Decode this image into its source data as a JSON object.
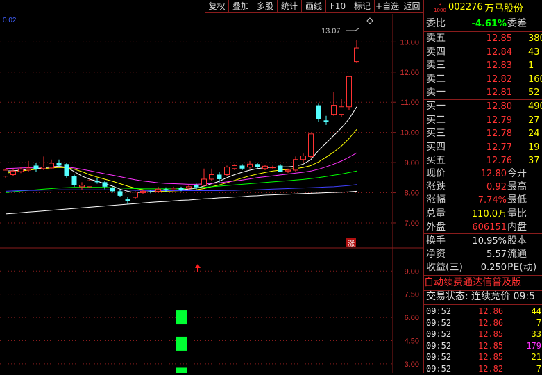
{
  "toolbar": {
    "buttons": [
      "复权",
      "叠加",
      "多股",
      "统计",
      "画线",
      "F10",
      "标记",
      "+自选",
      "返回"
    ]
  },
  "chart_header": {
    "left_value": "0.02",
    "peak_label": "13.07"
  },
  "chart_data": [
    {
      "type": "candlestick",
      "title": "",
      "ylim": [
        6.7,
        13.4
      ],
      "y_ticks": [
        "13.00",
        "12.00",
        "11.00",
        "10.00",
        "9.00",
        "8.00",
        "7.00"
      ],
      "candles": [
        {
          "o": 8.55,
          "c": 8.75,
          "h": 8.8,
          "l": 8.5
        },
        {
          "o": 8.6,
          "c": 8.72,
          "h": 8.78,
          "l": 8.55
        },
        {
          "o": 8.7,
          "c": 8.78,
          "h": 8.85,
          "l": 8.65
        },
        {
          "o": 8.75,
          "c": 8.82,
          "h": 9.05,
          "l": 8.7
        },
        {
          "o": 8.9,
          "c": 8.78,
          "h": 9.0,
          "l": 8.7
        },
        {
          "o": 8.8,
          "c": 8.85,
          "h": 9.2,
          "l": 8.75
        },
        {
          "o": 8.82,
          "c": 8.98,
          "h": 9.1,
          "l": 8.8
        },
        {
          "o": 9.0,
          "c": 8.9,
          "h": 9.1,
          "l": 8.85
        },
        {
          "o": 8.95,
          "c": 8.55,
          "h": 9.0,
          "l": 8.5
        },
        {
          "o": 8.55,
          "c": 8.25,
          "h": 8.6,
          "l": 8.2
        },
        {
          "o": 8.2,
          "c": 8.25,
          "h": 8.35,
          "l": 8.1
        },
        {
          "o": 8.2,
          "c": 8.4,
          "h": 8.45,
          "l": 8.15
        },
        {
          "o": 8.4,
          "c": 8.35,
          "h": 8.48,
          "l": 8.3
        },
        {
          "o": 8.35,
          "c": 8.2,
          "h": 8.4,
          "l": 8.12
        },
        {
          "o": 8.15,
          "c": 8.05,
          "h": 8.2,
          "l": 8.0
        },
        {
          "o": 8.05,
          "c": 7.9,
          "h": 8.1,
          "l": 7.85
        },
        {
          "o": 7.78,
          "c": 7.72,
          "h": 7.85,
          "l": 7.62
        },
        {
          "o": 7.85,
          "c": 8.02,
          "h": 8.05,
          "l": 7.8
        },
        {
          "o": 8.0,
          "c": 8.05,
          "h": 8.1,
          "l": 7.95
        },
        {
          "o": 8.05,
          "c": 8.02,
          "h": 8.1,
          "l": 7.98
        },
        {
          "o": 8.05,
          "c": 8.12,
          "h": 8.2,
          "l": 8.0
        },
        {
          "o": 8.12,
          "c": 8.08,
          "h": 8.18,
          "l": 8.02
        },
        {
          "o": 8.1,
          "c": 8.15,
          "h": 8.2,
          "l": 8.05
        },
        {
          "o": 8.15,
          "c": 8.1,
          "h": 8.2,
          "l": 8.05
        },
        {
          "o": 8.15,
          "c": 8.2,
          "h": 8.25,
          "l": 8.1
        },
        {
          "o": 8.25,
          "c": 8.18,
          "h": 8.3,
          "l": 8.12
        },
        {
          "o": 8.25,
          "c": 8.45,
          "h": 8.8,
          "l": 8.2
        },
        {
          "o": 8.45,
          "c": 8.6,
          "h": 8.8,
          "l": 8.4
        },
        {
          "o": 8.6,
          "c": 8.45,
          "h": 8.7,
          "l": 8.35
        },
        {
          "o": 8.6,
          "c": 8.85,
          "h": 8.9,
          "l": 8.55
        },
        {
          "o": 8.8,
          "c": 8.9,
          "h": 8.95,
          "l": 8.75
        },
        {
          "o": 8.9,
          "c": 8.8,
          "h": 8.95,
          "l": 8.75
        },
        {
          "o": 8.85,
          "c": 8.95,
          "h": 9.05,
          "l": 8.8
        },
        {
          "o": 8.95,
          "c": 8.85,
          "h": 9.0,
          "l": 8.8
        },
        {
          "o": 8.8,
          "c": 8.88,
          "h": 8.92,
          "l": 8.75
        },
        {
          "o": 8.85,
          "c": 8.85,
          "h": 8.9,
          "l": 8.8
        },
        {
          "o": 8.9,
          "c": 8.7,
          "h": 8.95,
          "l": 8.68
        },
        {
          "o": 8.72,
          "c": 8.75,
          "h": 8.8,
          "l": 8.65
        },
        {
          "o": 8.75,
          "c": 9.1,
          "h": 9.2,
          "l": 8.7
        },
        {
          "o": 9.1,
          "c": 9.22,
          "h": 9.3,
          "l": 9.0
        },
        {
          "o": 9.2,
          "c": 9.95,
          "h": 9.95,
          "l": 9.15
        },
        {
          "o": 10.9,
          "c": 10.45,
          "h": 10.95,
          "l": 10.35
        },
        {
          "o": 10.4,
          "c": 10.35,
          "h": 10.55,
          "l": 10.25
        },
        {
          "o": 10.6,
          "c": 10.9,
          "h": 11.35,
          "l": 10.55
        },
        {
          "o": 10.6,
          "c": 10.85,
          "h": 11.1,
          "l": 10.5
        },
        {
          "o": 10.85,
          "c": 11.85,
          "h": 11.85,
          "l": 10.75
        },
        {
          "o": 12.35,
          "c": 12.8,
          "h": 13.07,
          "l": 12.3
        }
      ],
      "series": [
        {
          "color": "#ffffff",
          "values": [
            8.72,
            8.73,
            8.75,
            8.78,
            8.8,
            8.82,
            8.86,
            8.88,
            8.84,
            8.7,
            8.55,
            8.45,
            8.38,
            8.3,
            8.22,
            8.12,
            8.05,
            8.0,
            8.02,
            8.04,
            8.06,
            8.08,
            8.09,
            8.1,
            8.12,
            8.15,
            8.22,
            8.3,
            8.38,
            8.5,
            8.6,
            8.68,
            8.75,
            8.8,
            8.83,
            8.85,
            8.86,
            8.86,
            8.88,
            8.95,
            9.1,
            9.4,
            9.65,
            9.9,
            10.15,
            10.45,
            10.85
          ]
        },
        {
          "color": "#ffff00",
          "values": [
            8.65,
            8.68,
            8.72,
            8.75,
            8.78,
            8.8,
            8.82,
            8.84,
            8.83,
            8.78,
            8.7,
            8.6,
            8.52,
            8.45,
            8.38,
            8.3,
            8.22,
            8.15,
            8.1,
            8.07,
            8.05,
            8.05,
            8.06,
            8.07,
            8.08,
            8.1,
            8.14,
            8.2,
            8.26,
            8.33,
            8.41,
            8.49,
            8.56,
            8.62,
            8.67,
            8.72,
            8.75,
            8.78,
            8.8,
            8.84,
            8.9,
            9.02,
            9.18,
            9.35,
            9.55,
            9.8,
            10.1
          ]
        },
        {
          "color": "#ff33ff",
          "values": [
            8.8,
            8.81,
            8.82,
            8.83,
            8.84,
            8.85,
            8.86,
            8.86,
            8.85,
            8.82,
            8.78,
            8.73,
            8.68,
            8.63,
            8.58,
            8.53,
            8.48,
            8.43,
            8.39,
            8.36,
            8.33,
            8.31,
            8.3,
            8.29,
            8.28,
            8.28,
            8.29,
            8.31,
            8.33,
            8.36,
            8.39,
            8.42,
            8.46,
            8.5,
            8.53,
            8.56,
            8.59,
            8.62,
            8.65,
            8.68,
            8.72,
            8.78,
            8.86,
            8.95,
            9.05,
            9.18,
            9.32
          ]
        },
        {
          "color": "#00ff00",
          "values": [
            8.0,
            8.03,
            8.06,
            8.08,
            8.1,
            8.12,
            8.14,
            8.16,
            8.17,
            8.18,
            8.18,
            8.18,
            8.18,
            8.18,
            8.17,
            8.16,
            8.15,
            8.14,
            8.13,
            8.13,
            8.13,
            8.13,
            8.13,
            8.14,
            8.15,
            8.16,
            8.18,
            8.2,
            8.22,
            8.24,
            8.26,
            8.28,
            8.3,
            8.32,
            8.34,
            8.36,
            8.38,
            8.4,
            8.42,
            8.44,
            8.47,
            8.5,
            8.54,
            8.58,
            8.62,
            8.67,
            8.72
          ]
        },
        {
          "color": "#4040ff",
          "values": [
            8.05,
            8.06,
            8.07,
            8.08,
            8.08,
            8.09,
            8.09,
            8.1,
            8.1,
            8.1,
            8.1,
            8.1,
            8.1,
            8.1,
            8.1,
            8.09,
            8.09,
            8.08,
            8.08,
            8.07,
            8.07,
            8.07,
            8.07,
            8.07,
            8.07,
            8.07,
            8.07,
            8.07,
            8.07,
            8.08,
            8.08,
            8.09,
            8.09,
            8.1,
            8.11,
            8.12,
            8.13,
            8.14,
            8.15,
            8.16,
            8.17,
            8.18,
            8.19,
            8.2,
            8.22,
            8.24,
            8.27
          ]
        },
        {
          "color": "#ffffff",
          "values": [
            7.3,
            7.32,
            7.34,
            7.36,
            7.38,
            7.4,
            7.42,
            7.44,
            7.46,
            7.48,
            7.5,
            7.52,
            7.54,
            7.56,
            7.58,
            7.6,
            7.62,
            7.64,
            7.66,
            7.68,
            7.7,
            7.71,
            7.73,
            7.75,
            7.76,
            7.78,
            7.8,
            7.81,
            7.83,
            7.84,
            7.86,
            7.87,
            7.89,
            7.9,
            7.92,
            7.93,
            7.94,
            7.95,
            7.96,
            7.97,
            7.98,
            7.99,
            8.0,
            8.01,
            8.02,
            8.03,
            8.05
          ]
        }
      ],
      "badge": "涨"
    },
    {
      "type": "bar",
      "title": "",
      "ylim": [
        2.5,
        10.0
      ],
      "y_ticks": [
        "9.00",
        "7.50",
        "6.00",
        "4.50",
        "3.00"
      ],
      "bars": [
        6.0,
        4.3,
        2.3
      ],
      "bar_index": 23
    }
  ],
  "quote": {
    "code": "002276",
    "name": "万马股份",
    "weibi_label": "委比",
    "weibi_value": "-4.61%",
    "weicha_label": "委差",
    "asks": [
      {
        "label": "卖五",
        "price": "12.85",
        "vol": "380"
      },
      {
        "label": "卖四",
        "price": "12.84",
        "vol": "43"
      },
      {
        "label": "卖三",
        "price": "12.83",
        "vol": "1"
      },
      {
        "label": "卖二",
        "price": "12.82",
        "vol": "160"
      },
      {
        "label": "卖一",
        "price": "12.81",
        "vol": "52"
      }
    ],
    "bids": [
      {
        "label": "买一",
        "price": "12.80",
        "vol": "490"
      },
      {
        "label": "买二",
        "price": "12.79",
        "vol": "27"
      },
      {
        "label": "买三",
        "price": "12.78",
        "vol": "24"
      },
      {
        "label": "买四",
        "price": "12.77",
        "vol": "19"
      },
      {
        "label": "买五",
        "price": "12.76",
        "vol": "37"
      }
    ],
    "stats": [
      {
        "label": "现价",
        "value": "12.80",
        "label2": "今开",
        "color": "#ff3232"
      },
      {
        "label": "涨跌",
        "value": "0.92",
        "label2": "最高",
        "color": "#ff3232"
      },
      {
        "label": "涨幅",
        "value": "7.74%",
        "label2": "最低",
        "color": "#ff3232"
      },
      {
        "label": "总量",
        "value": "110.0万",
        "label2": "量比",
        "color": "#ffff00"
      },
      {
        "label": "外盘",
        "value": "606151",
        "label2": "内盘",
        "color": "#ff3232"
      }
    ],
    "stats2": [
      {
        "label": "换手",
        "value": "10.95%",
        "label2": "股本"
      },
      {
        "label": "净资",
        "value": "5.57",
        "label2": "流通"
      },
      {
        "label": "收益(三)",
        "value": "0.250",
        "label2": "PE(动)"
      }
    ],
    "promo": "自动续费通达信普及版",
    "trade_status": "交易状态: 连续竞价 09:5",
    "ticks": [
      {
        "time": "09:52",
        "price": "12.86",
        "vol": "44",
        "color": "#ffff00"
      },
      {
        "time": "09:52",
        "price": "12.86",
        "vol": "7",
        "color": "#ffff00"
      },
      {
        "time": "09:52",
        "price": "12.85",
        "vol": "33",
        "color": "#ffff00"
      },
      {
        "time": "09:52",
        "price": "12.85",
        "vol": "179",
        "color": "#ff33ff"
      },
      {
        "time": "09:52",
        "price": "12.85",
        "vol": "21",
        "color": "#ffff00"
      },
      {
        "time": "09:52",
        "price": "12.82",
        "vol": "7",
        "color": "#ffff00"
      }
    ]
  }
}
